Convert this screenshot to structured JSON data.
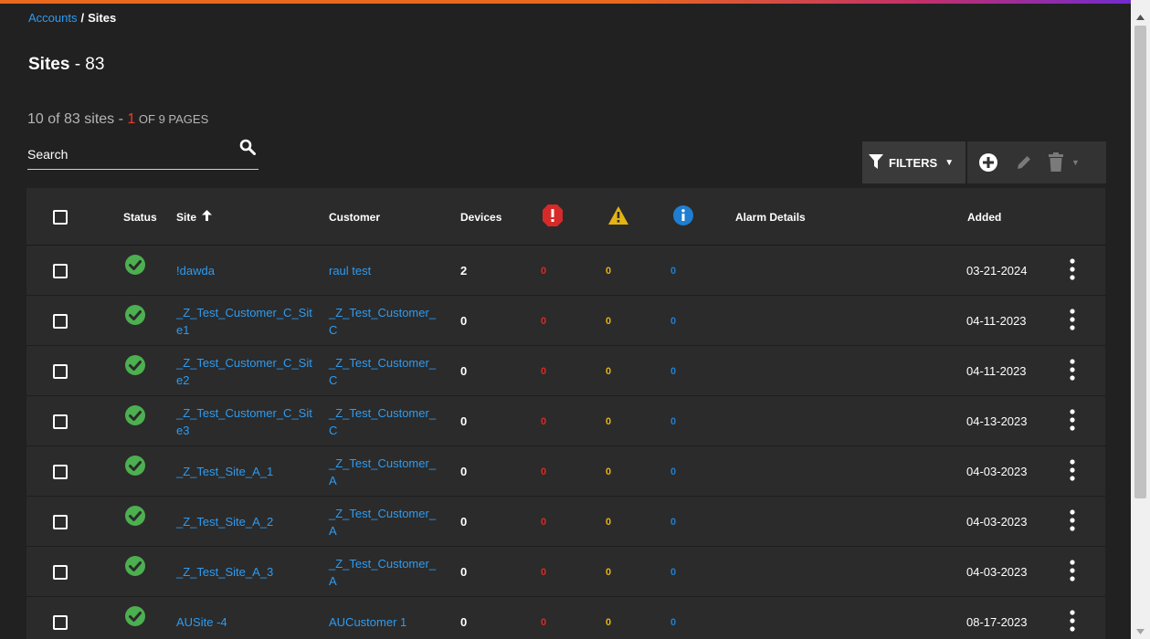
{
  "breadcrumb": {
    "parent": "Accounts",
    "separator": "/",
    "current": "Sites"
  },
  "title": {
    "main": "Sites",
    "count": " - 83"
  },
  "summary": {
    "range": "10 of 83 sites - ",
    "current_page": "1",
    "pages_label": " OF 9 PAGES"
  },
  "search": {
    "placeholder": "Search",
    "value": ""
  },
  "toolbar": {
    "filters_label": "FILTERS"
  },
  "table": {
    "headers": {
      "status": "Status",
      "site": "Site",
      "customer": "Customer",
      "devices": "Devices",
      "alarm_details": "Alarm Details",
      "added": "Added"
    },
    "rows": [
      {
        "site": "!dawda",
        "customer": "raul test",
        "devices": "2",
        "critical": "0",
        "warning": "0",
        "info": "0",
        "alarm_details": "",
        "added": "03-21-2024"
      },
      {
        "site": "_Z_Test_Customer_C_Site1",
        "customer": "_Z_Test_Customer_C",
        "devices": "0",
        "critical": "0",
        "warning": "0",
        "info": "0",
        "alarm_details": "",
        "added": "04-11-2023"
      },
      {
        "site": "_Z_Test_Customer_C_Site2",
        "customer": "_Z_Test_Customer_C",
        "devices": "0",
        "critical": "0",
        "warning": "0",
        "info": "0",
        "alarm_details": "",
        "added": "04-11-2023"
      },
      {
        "site": "_Z_Test_Customer_C_Site3",
        "customer": "_Z_Test_Customer_C",
        "devices": "0",
        "critical": "0",
        "warning": "0",
        "info": "0",
        "alarm_details": "",
        "added": "04-13-2023"
      },
      {
        "site": "_Z_Test_Site_A_1",
        "customer": "_Z_Test_Customer_A",
        "devices": "0",
        "critical": "0",
        "warning": "0",
        "info": "0",
        "alarm_details": "",
        "added": "04-03-2023"
      },
      {
        "site": "_Z_Test_Site_A_2",
        "customer": "_Z_Test_Customer_A",
        "devices": "0",
        "critical": "0",
        "warning": "0",
        "info": "0",
        "alarm_details": "",
        "added": "04-03-2023"
      },
      {
        "site": "_Z_Test_Site_A_3",
        "customer": "_Z_Test_Customer_A",
        "devices": "0",
        "critical": "0",
        "warning": "0",
        "info": "0",
        "alarm_details": "",
        "added": "04-03-2023"
      },
      {
        "site": "AUSite -4",
        "customer": "AUCustomer 1",
        "devices": "0",
        "critical": "0",
        "warning": "0",
        "info": "0",
        "alarm_details": "",
        "added": "08-17-2023"
      }
    ]
  },
  "colors": {
    "background": "#212121",
    "table_background": "#2b2b2b",
    "link": "#2e9bf0",
    "status_ok": "#4caf50",
    "critical": "#d62a2a",
    "warning": "#e4b414",
    "info": "#1f7ed0",
    "page_highlight": "#f03a2e"
  },
  "icons": {
    "search": "search-icon",
    "filter": "filter-icon",
    "add": "add-circle-icon",
    "edit": "pencil-icon",
    "delete": "trash-icon",
    "sort": "arrow-up-icon",
    "status": "check-circle-icon",
    "critical": "critical-alarm-icon",
    "warning": "warning-triangle-icon",
    "info": "info-circle-icon",
    "row_menu": "kebab-menu-icon"
  }
}
